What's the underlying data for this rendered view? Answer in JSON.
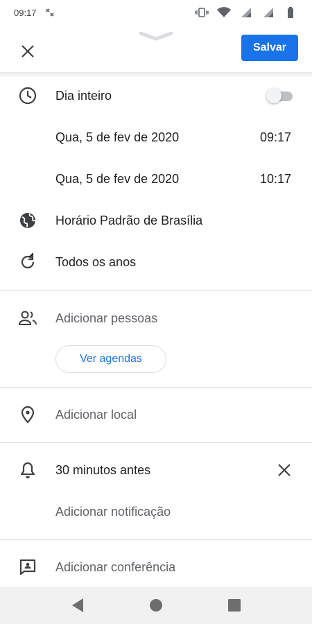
{
  "status_bar": {
    "time": "09:17",
    "icons": [
      "nfc-icon",
      "vibrate-icon",
      "wifi-icon",
      "signal-icon",
      "signal-icon",
      "battery-icon"
    ]
  },
  "header": {
    "save_label": "Salvar",
    "close_icon": "close-icon",
    "accent_color": "#1a73e8"
  },
  "schedule": {
    "all_day_label": "Dia inteiro",
    "all_day_enabled": false,
    "start_date": "Qua, 5 de fev de 2020",
    "start_time": "09:17",
    "end_date": "Qua, 5 de fev de 2020",
    "end_time": "10:17",
    "timezone": "Horário Padrão de Brasília",
    "repeat": "Todos os anos"
  },
  "people": {
    "add_people_label": "Adicionar pessoas",
    "view_schedules_label": "Ver agendas"
  },
  "location": {
    "add_location_label": "Adicionar local"
  },
  "notifications": {
    "reminder": "30 minutos antes",
    "add_notification_label": "Adicionar notificação"
  },
  "conference": {
    "add_conference_label": "Adicionar conferência"
  },
  "nav_bar": {
    "buttons": [
      "back-icon",
      "home-icon",
      "recents-icon"
    ]
  }
}
